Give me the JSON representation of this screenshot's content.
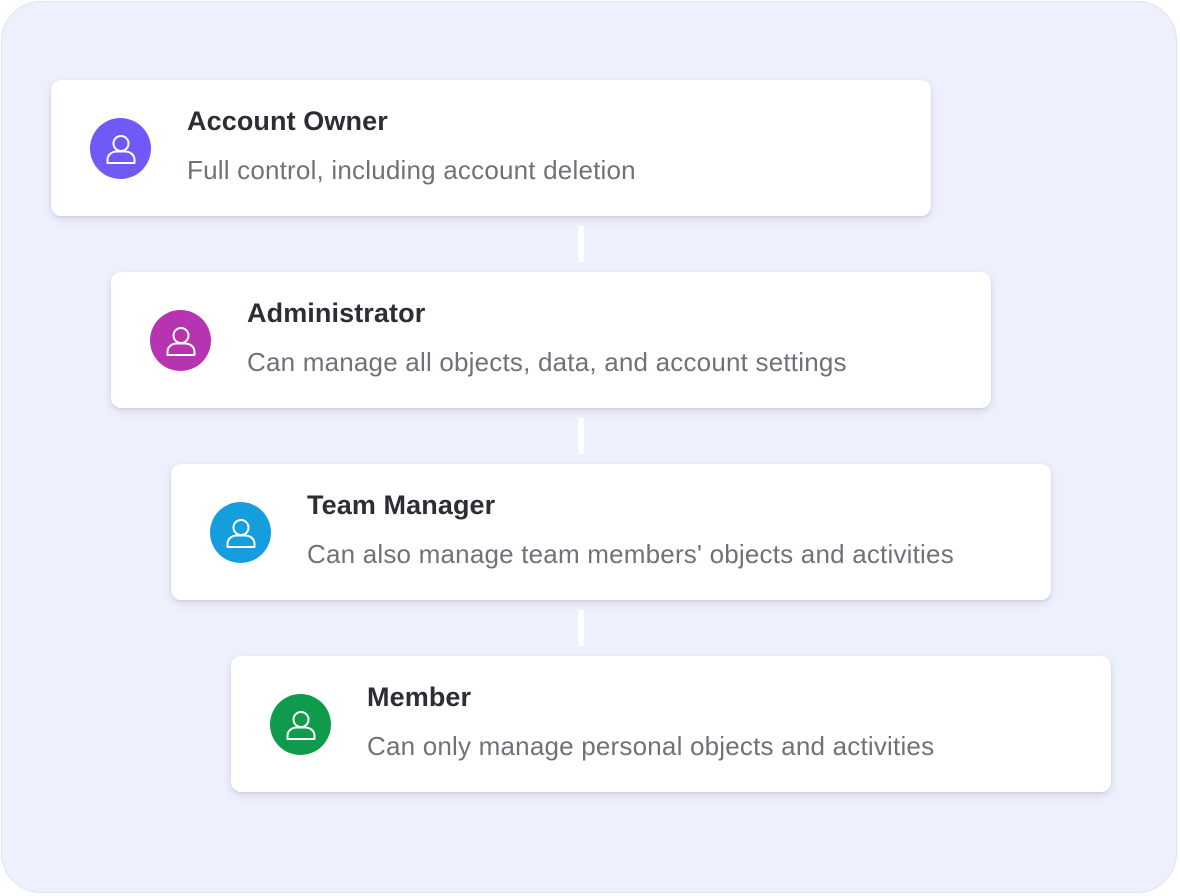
{
  "roles": [
    {
      "title": "Account Owner",
      "description": "Full control, including account deletion",
      "avatar_color": "#6f59f7",
      "icon": "user-icon"
    },
    {
      "title": "Administrator",
      "description": "Can manage all objects, data, and account settings",
      "avatar_color": "#b634b0",
      "icon": "user-icon"
    },
    {
      "title": "Team Manager",
      "description": "Can also manage team members' objects and activities",
      "avatar_color": "#149ede",
      "icon": "user-icon"
    },
    {
      "title": "Member",
      "description": "Can only manage personal objects and activities",
      "avatar_color": "#0f9b4c",
      "icon": "user-icon"
    }
  ],
  "colors": {
    "panel_background": "#eef0fd",
    "card_background": "#ffffff",
    "title_text": "#2b2e35",
    "description_text": "#6e727a"
  }
}
